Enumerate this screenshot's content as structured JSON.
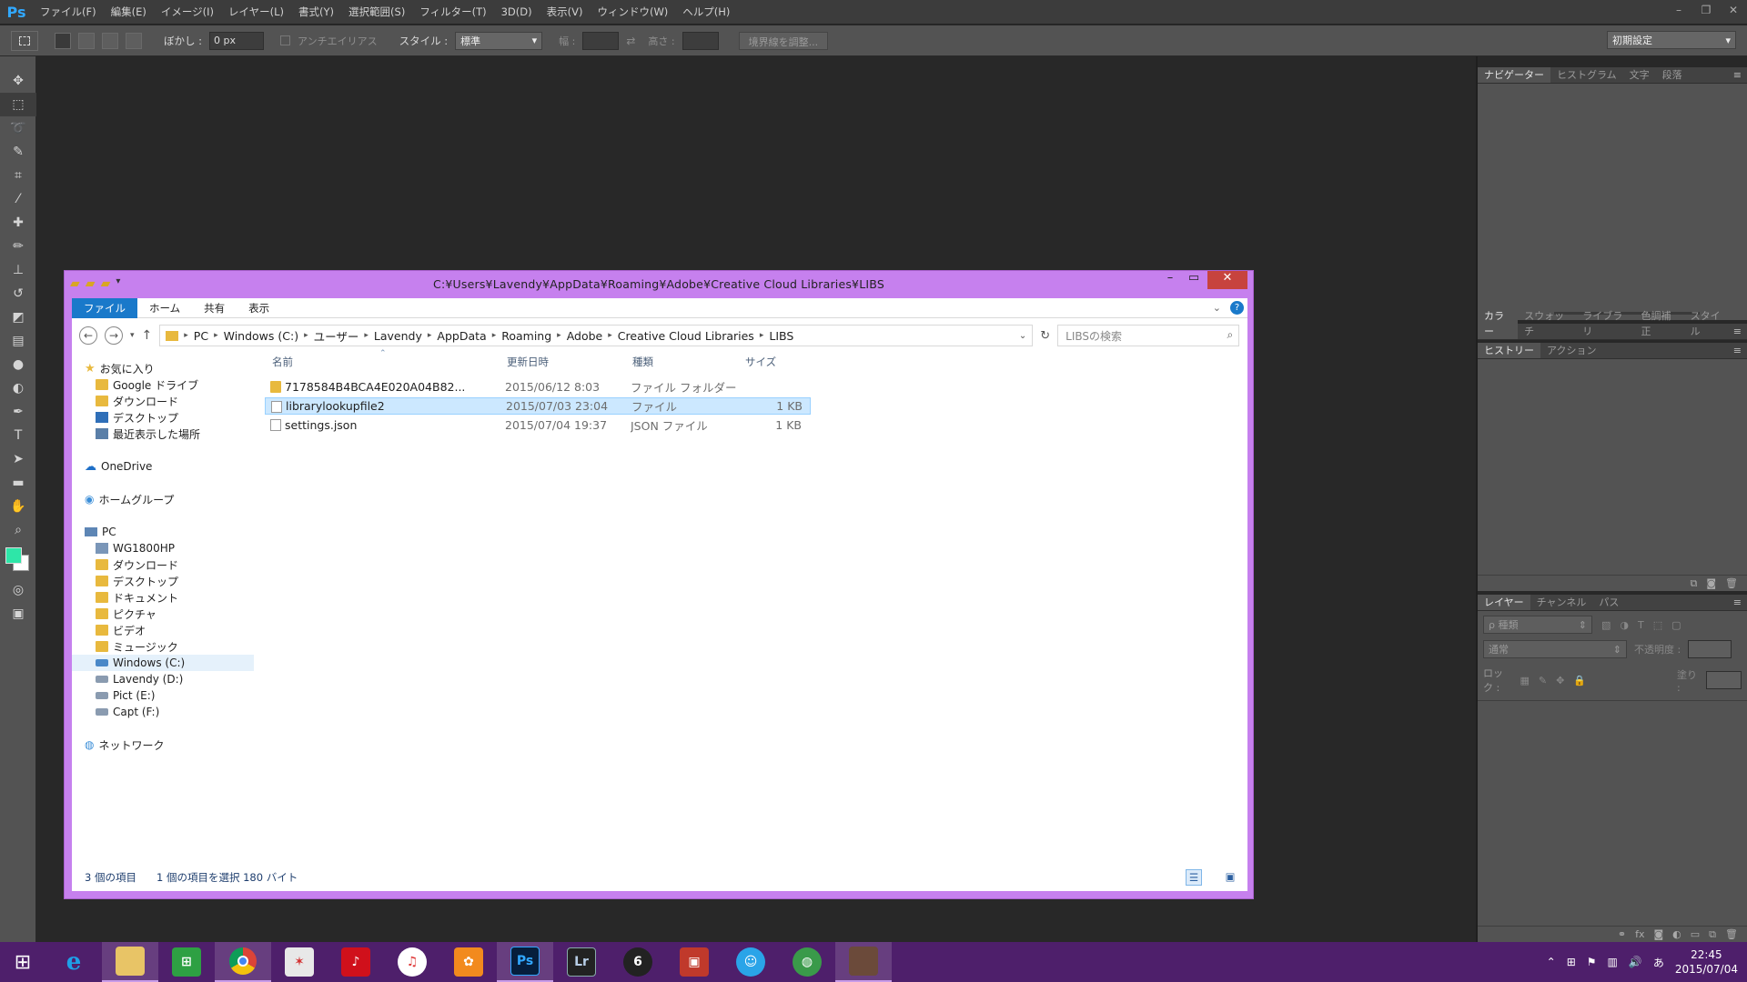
{
  "app": {
    "logo": "Ps"
  },
  "menu": [
    "ファイル(F)",
    "編集(E)",
    "イメージ(I)",
    "レイヤー(L)",
    "書式(Y)",
    "選択範囲(S)",
    "フィルター(T)",
    "3D(D)",
    "表示(V)",
    "ウィンドウ(W)",
    "ヘルプ(H)"
  ],
  "window_controls": {
    "minimize": "–",
    "restore": "❐",
    "close": "✕"
  },
  "options": {
    "feather_label": "ぼかし :",
    "feather_value": "0 px",
    "antialias_label": "アンチエイリアス",
    "style_label": "スタイル :",
    "style_value": "標準",
    "width_label": "幅 :",
    "height_label": "高さ :",
    "refine_edge": "境界線を調整...",
    "preset": "初期設定"
  },
  "tools": [
    "move-tool",
    "marquee-tool",
    "lasso-tool",
    "quick-selection-tool",
    "crop-tool",
    "eyedropper-tool",
    "healing-brush-tool",
    "brush-tool",
    "clone-stamp-tool",
    "history-brush-tool",
    "eraser-tool",
    "gradient-tool",
    "blur-tool",
    "dodge-tool",
    "pen-tool",
    "type-tool",
    "path-selection-tool",
    "rectangle-tool",
    "hand-tool",
    "zoom-tool"
  ],
  "colors": {
    "foreground": "#2ee6a8",
    "background": "#ffffff",
    "accent": "#c680ee",
    "taskbar": "#4e1f6b"
  },
  "panels": {
    "navigator_tabs": [
      "ナビゲーター",
      "ヒストグラム",
      "文字",
      "段落"
    ],
    "color_tabs": [
      "カラー",
      "スウォッチ",
      "ライブラリ",
      "色調補正",
      "スタイル"
    ],
    "history_tabs": [
      "ヒストリー",
      "アクション"
    ],
    "layers_tabs": [
      "レイヤー",
      "チャンネル",
      "パス"
    ],
    "layers_kind": "ρ 種類",
    "blend_mode": "通常",
    "opacity_label": "不透明度 :",
    "lock_label": "ロック :",
    "fill_label": "塗り :"
  },
  "explorer": {
    "title": "C:¥Users¥Lavendy¥AppData¥Roaming¥Adobe¥Creative Cloud Libraries¥LIBS",
    "ribbon_tabs": [
      "ファイル",
      "ホーム",
      "共有",
      "表示"
    ],
    "breadcrumb": [
      "PC",
      "Windows (C:)",
      "ユーザー",
      "Lavendy",
      "AppData",
      "Roaming",
      "Adobe",
      "Creative Cloud Libraries",
      "LIBS"
    ],
    "search_placeholder": "LIBSの検索",
    "nav": [
      {
        "label": "お気に入り",
        "icon": "star-icon"
      },
      {
        "label": "Google ドライブ",
        "icon": "folder-icon"
      },
      {
        "label": "ダウンロード",
        "icon": "folder-icon"
      },
      {
        "label": "デスクトップ",
        "icon": "desktop-icon"
      },
      {
        "label": "最近表示した場所",
        "icon": "recent-icon"
      },
      {
        "label": "OneDrive",
        "icon": "cloud-icon"
      },
      {
        "label": "ホームグループ",
        "icon": "homegroup-icon"
      },
      {
        "label": "PC",
        "icon": "computer-icon"
      },
      {
        "label": "WG1800HP",
        "icon": "folder-icon"
      },
      {
        "label": "ダウンロード",
        "icon": "folder-icon"
      },
      {
        "label": "デスクトップ",
        "icon": "folder-icon"
      },
      {
        "label": "ドキュメント",
        "icon": "folder-icon"
      },
      {
        "label": "ピクチャ",
        "icon": "folder-icon"
      },
      {
        "label": "ビデオ",
        "icon": "folder-icon"
      },
      {
        "label": "ミュージック",
        "icon": "folder-icon"
      },
      {
        "label": "Windows (C:)",
        "icon": "drive-icon"
      },
      {
        "label": "Lavendy (D:)",
        "icon": "drive-icon"
      },
      {
        "label": "Pict (E:)",
        "icon": "drive-icon"
      },
      {
        "label": "Capt (F:)",
        "icon": "drive-icon"
      },
      {
        "label": "ネットワーク",
        "icon": "network-icon"
      }
    ],
    "columns": [
      "名前",
      "更新日時",
      "種類",
      "サイズ"
    ],
    "files": [
      {
        "name": "7178584B4BCA4E020A04B82...",
        "date": "2015/06/12 8:03",
        "type": "ファイル フォルダー",
        "size": ""
      },
      {
        "name": "librarylookupfile2",
        "date": "2015/07/03 23:04",
        "type": "ファイル",
        "size": "1 KB"
      },
      {
        "name": "settings.json",
        "date": "2015/07/04 19:37",
        "type": "JSON ファイル",
        "size": "1 KB"
      }
    ],
    "status_count": "3 個の項目",
    "status_selected": "1 個の項目を選択 180 バイト"
  },
  "taskbar": {
    "apps": [
      "start",
      "internet-explorer",
      "file-explorer",
      "store",
      "chrome",
      "acrobat",
      "app-red",
      "itunes",
      "app-orange",
      "photoshop",
      "lightroom",
      "app-6",
      "app-box",
      "app-blue",
      "app-globe",
      "app-avatar"
    ],
    "ps_label": "Ps",
    "lr_label": "Lr",
    "time": "22:45",
    "date": "2015/07/04"
  }
}
